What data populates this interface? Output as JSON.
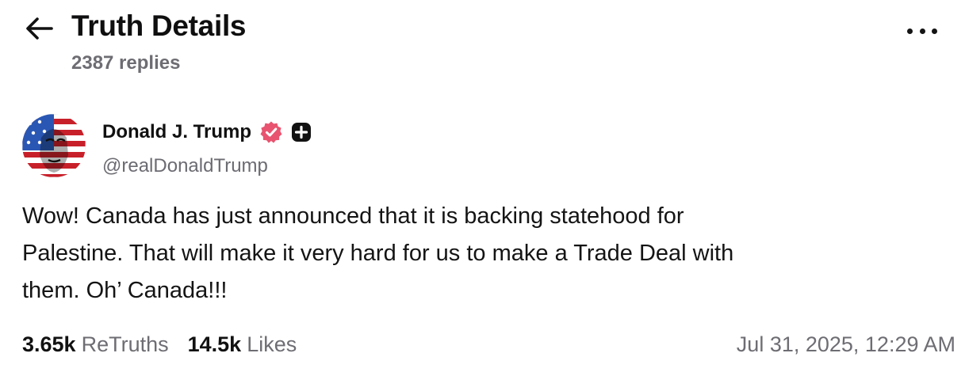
{
  "header": {
    "title": "Truth Details",
    "replies": "2387 replies",
    "back_icon": "arrow-left-icon",
    "more_icon": "more-horizontal-icon"
  },
  "author": {
    "name": "Donald J. Trump",
    "handle": "@realDonaldTrump",
    "verified_icon": "verified-badge-icon",
    "verified_color": "#e8546f",
    "plus_icon": "plus-badge-icon"
  },
  "post": {
    "lines": [
      "Wow! Canada has just announced that it is backing statehood for",
      "Palestine. That will make it very hard for us to make a Trade Deal with",
      "them. Oh’ Canada!!!"
    ]
  },
  "stats": {
    "retruths_count": "3.65k",
    "retruths_label": "ReTruths",
    "likes_count": "14.5k",
    "likes_label": "Likes",
    "timestamp": "Jul 31, 2025, 12:29 AM"
  }
}
